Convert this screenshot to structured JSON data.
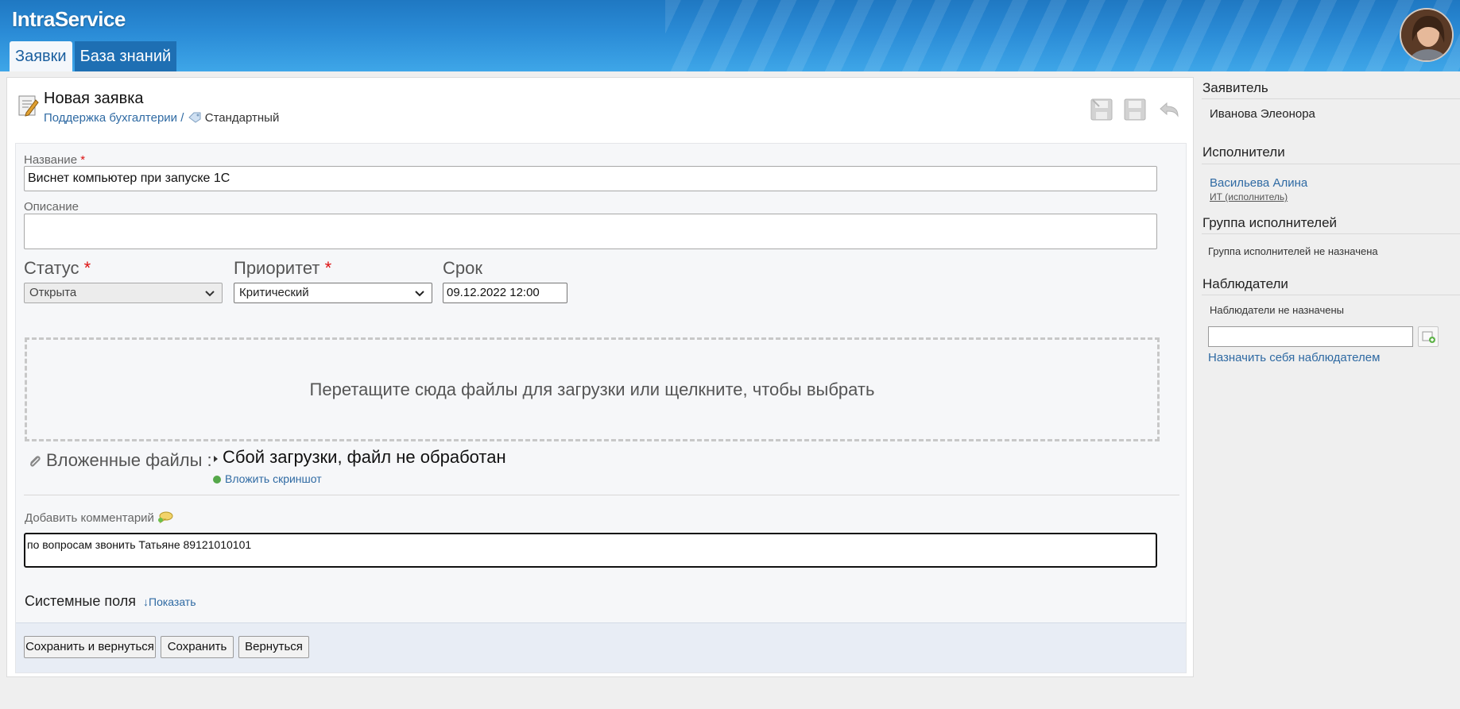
{
  "app": {
    "logo": "IntraService",
    "tabs": [
      {
        "label": "Заявки",
        "active": true
      },
      {
        "label": "База знаний",
        "active": false
      }
    ]
  },
  "page": {
    "title": "Новая заявка",
    "breadcrumb": {
      "service": "Поддержка бухгалтерии",
      "separator": "/",
      "type": "Стандартный"
    }
  },
  "form": {
    "name": {
      "label": "Название",
      "required": "*",
      "value": "Виснет компьютер при запуске 1С"
    },
    "description": {
      "label": "Описание",
      "value": ""
    },
    "status": {
      "label": "Статус",
      "required": "*",
      "value": "Открыта"
    },
    "priority": {
      "label": "Приоритет",
      "required": "*",
      "value": "Критический"
    },
    "deadline": {
      "label": "Срок",
      "value": "09.12.2022 12:00"
    },
    "dropzone_text": "Перетащите сюда файлы для загрузки или щелкните, чтобы выбрать",
    "attachments": {
      "label": "Вложенные файлы :",
      "error": "Сбой загрузки, файл не обработан",
      "screenshot_link": "Вложить скриншот"
    },
    "comment": {
      "label": "Добавить комментарий",
      "value": "по вопросам звонить Татьяне 89121010101"
    },
    "system_fields": {
      "label": "Системные поля",
      "toggle": "↓Показать"
    }
  },
  "buttons": {
    "save_return": "Сохранить и вернуться",
    "save": "Сохранить",
    "back": "Вернуться"
  },
  "sidebar": {
    "requester": {
      "heading": "Заявитель",
      "name": "Иванова Элеонора"
    },
    "executors": {
      "heading": "Исполнители",
      "name": "Васильева Алина",
      "role": "ИТ (исполнитель)"
    },
    "group": {
      "heading": "Группа исполнителей",
      "text": "Группа исполнителей не назначена"
    },
    "observers": {
      "heading": "Наблюдатели",
      "text": "Наблюдатели не назначены",
      "assign_self": "Назначить себя наблюдателем"
    }
  },
  "colors": {
    "header_blue": "#2a8bd6",
    "link": "#2f6aa3",
    "required": "#dd1111",
    "footer_bar": "#e8edf5"
  },
  "icons": [
    "document-edit-icon",
    "service-tag-icon",
    "save-close-icon",
    "save-icon",
    "undo-icon",
    "chevron-down-icon",
    "paperclip-icon",
    "add-icon",
    "comment-icon",
    "add-user-icon"
  ]
}
